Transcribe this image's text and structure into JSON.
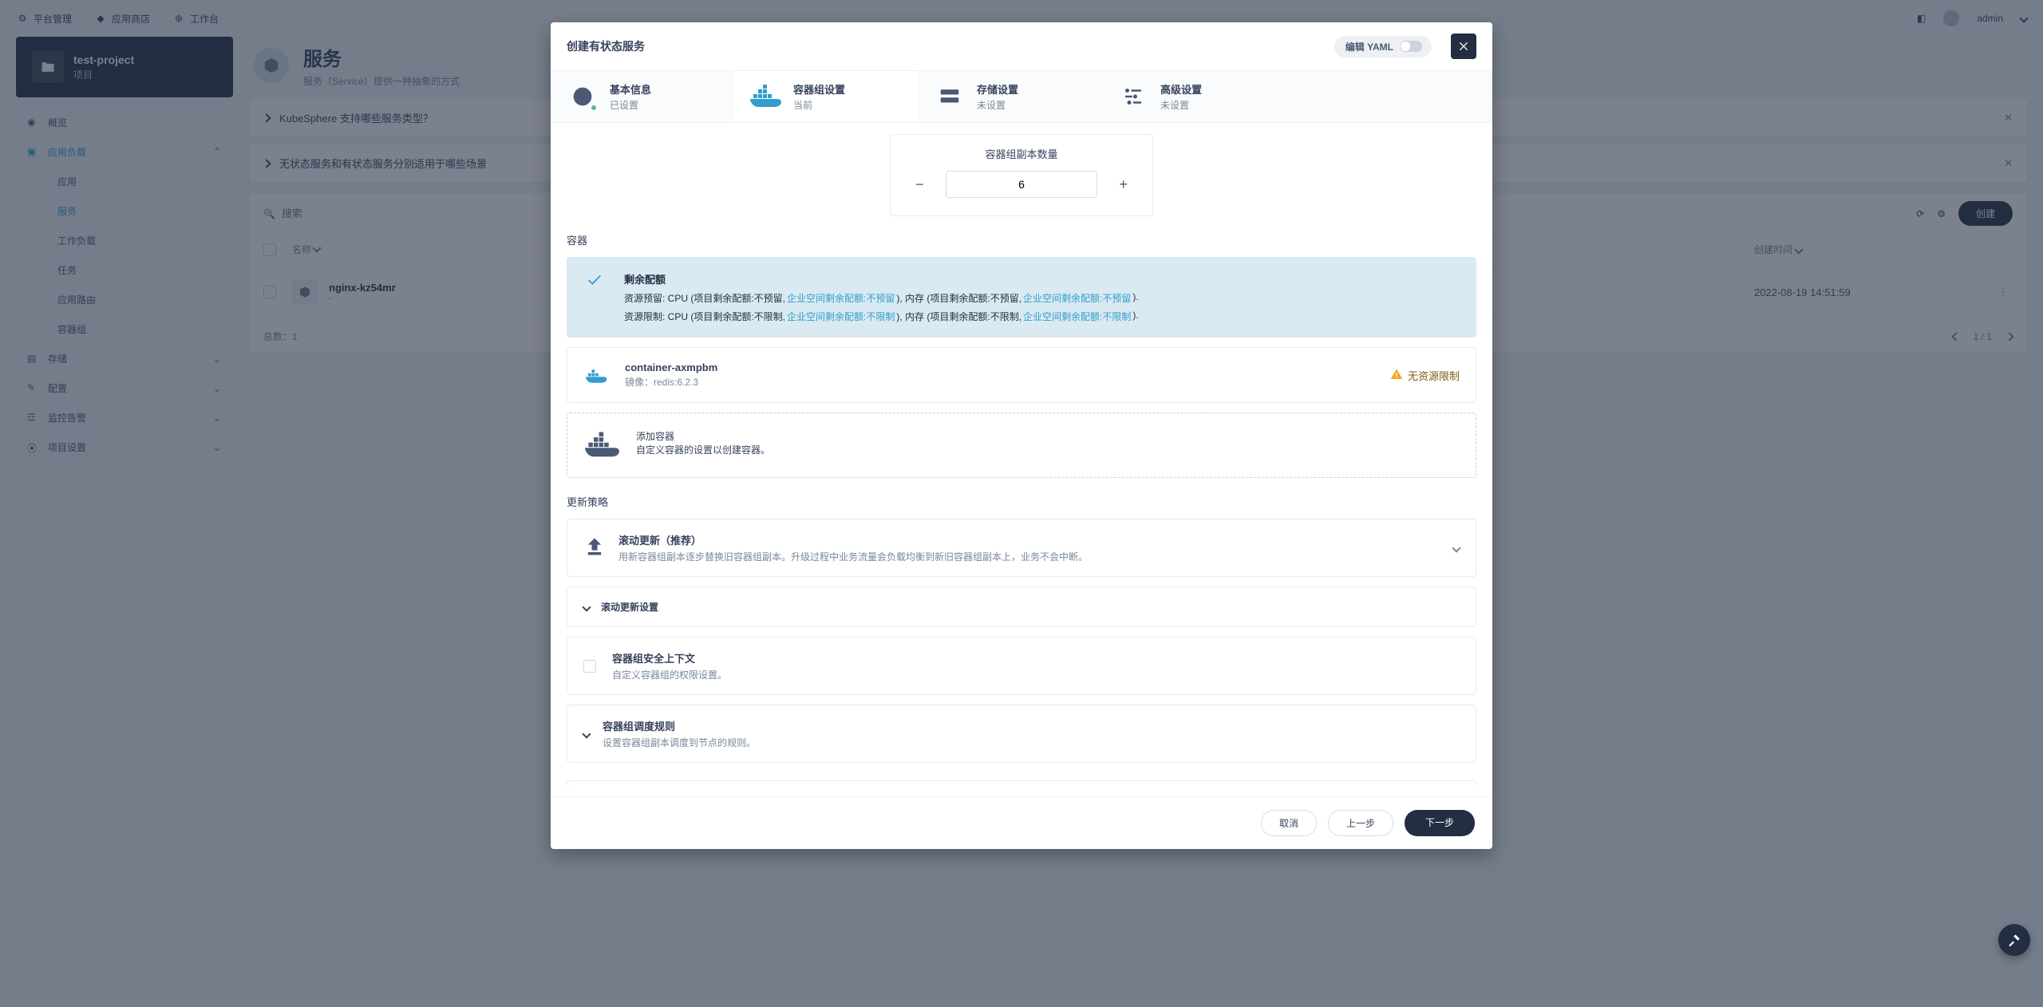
{
  "colors": {
    "accent": "#329dce",
    "dark": "#242e42",
    "warn": "#f5a623",
    "success": "#55bc8a"
  },
  "topbar": {
    "platform": "平台管理",
    "store": "应用商店",
    "workspace": "工作台",
    "user": "admin"
  },
  "project": {
    "name": "test-project",
    "subtitle": "项目"
  },
  "sidebar": {
    "overview": "概览",
    "workload_group": "应用负载",
    "workload_items": [
      "应用",
      "服务",
      "工作负载",
      "任务",
      "应用路由",
      "容器组"
    ],
    "active_workload_index": 1,
    "storage": "存储",
    "config": "配置",
    "monitor": "监控告警",
    "settings": "项目设置"
  },
  "page": {
    "title": "服务",
    "subtitle": "服务（Service）提供一种抽象的方式",
    "faq": [
      "KubeSphere 支持哪些服务类型？",
      "无状态服务和有状态服务分别适用于哪些场景"
    ],
    "search_placeholder": "搜索",
    "create": "创建",
    "columns": {
      "name": "名称",
      "created": "创建时间"
    },
    "rows": [
      {
        "name": "nginx-kz54mr",
        "sub": "-",
        "created": "2022-08-19 14:51:59"
      }
    ],
    "total_label": "总数：",
    "total": 1,
    "pager": "1 / 1"
  },
  "modal": {
    "title": "创建有状态服务",
    "edit_yaml": "编辑 YAML",
    "tabs": [
      {
        "label": "基本信息",
        "status": "已设置",
        "status_kind": "done"
      },
      {
        "label": "容器组设置",
        "status": "当前",
        "status_kind": "current"
      },
      {
        "label": "存储设置",
        "status": "未设置",
        "status_kind": "pending"
      },
      {
        "label": "高级设置",
        "status": "未设置",
        "status_kind": "pending"
      }
    ],
    "replica_label": "容器组副本数量",
    "replica_value": "6",
    "container_label": "容器",
    "quota": {
      "title": "剩余配额",
      "line1_pre": "资源预留: CPU (项目剩余配额:不预留,",
      "line1_a": "企业空间剩余配额:不预留",
      "line1_mid": "),  内存 (项目剩余配额:不预留,",
      "line1_b": "企业空间剩余配额:不预留",
      "line1_post": ").",
      "line2_pre": "资源限制: CPU (项目剩余配额:不限制,",
      "line2_a": "企业空间剩余配额:不限制",
      "line2_mid": "),  内存 (项目剩余配额:不限制,",
      "line2_b": "企业空间剩余配额:不限制",
      "line2_post": ")."
    },
    "container_item": {
      "name": "container-axmpbm",
      "image_label": "镜像：",
      "image": "redis:6.2.3",
      "warn": "无资源限制"
    },
    "add_container": {
      "title": "添加容器",
      "desc": "自定义容器的设置以创建容器。"
    },
    "update_label": "更新策略",
    "rolling": {
      "title": "滚动更新（推荐）",
      "desc": "用新容器组副本逐步替换旧容器组副本。升级过程中业务流量会负载均衡到新旧容器组副本上，业务不会中断。"
    },
    "rolling_settings": "滚动更新设置",
    "security": {
      "title": "容器组安全上下文",
      "desc": "自定义容器组的权限设置。"
    },
    "scheduling": {
      "title": "容器组调度规则",
      "desc": "设置容器组副本调度到节点的规则。"
    },
    "footer": {
      "cancel": "取消",
      "prev": "上一步",
      "next": "下一步"
    }
  }
}
